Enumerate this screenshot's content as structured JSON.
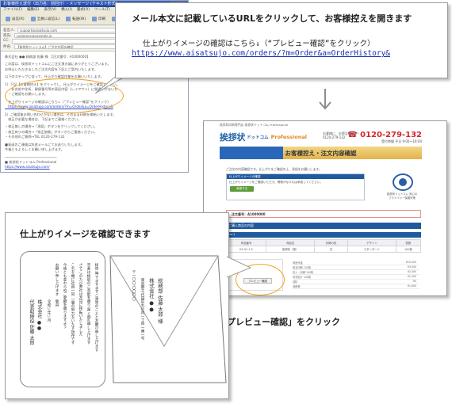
{
  "email": {
    "title_bar": "お客様控え送付（出力名：前回分）- メッセージ (テキスト形式)",
    "menu": [
      "ファイル(F)",
      "編集(E)",
      "表示(V)",
      "挿入(I)",
      "書式(O)",
      "ツール(T)",
      "アクション(A)",
      "ヘルプ(H)"
    ],
    "toolbar": [
      "返信(R)",
      "全員に返信(L)",
      "転送(W)",
      "印刷",
      "削除",
      "前へ",
      "次へ"
    ],
    "headers": {
      "from_label": "差出人:",
      "from_value": "support@aisatsujo.com",
      "to_label": "宛先:",
      "to_value": "customer@example.jp",
      "cc_label": "CC:",
      "cc_value": "",
      "subject_label": "件名:",
      "subject_value": "【挨拶状ドットコム】ご注文内容の確認"
    },
    "body_lines": [
      "株式会社 ●● 総務部 佐藤 様　【注文番号：A1000000】",
      "",
      "この度は、挨拶状ドットコムにご注文頂き誠にありがとうございます。",
      "お申込いただきましたご注文内容を下記にご案内いたします。",
      "",
      "以下のステップに従って、仕上がり確認作業をお願いいたします。",
      "",
      "1）下記【お客様控え】をクリックし、仕上がりイメージをご確認ください。",
      "　・お名前や住所、郵便番号等の表記内容（レイアウト）に間違いがないか",
      "　・ご確認をお願いします。",
      "",
      "　仕上がりイメージの確認はこちら↓（“プレビュー確認”をクリック）",
      "　https://www.aisatsujo.com/orders/?m=Order&a=OrderHistory&",
      "",
      "2）ご確認後お問い合わせがない場合は、そのまま印刷を開始いたします。",
      "　修正が必要な場合は、下記までご連絡ください。",
      "",
      "・修正無しの場合→「承認」ボタンをクリックしてください。",
      "・修正有りの場合→「修正依頼」ボタンからご連絡ください。",
      "・その他のご質問→TEL 0120-279-132",
      "",
      "■発送のご連絡は別途メールにてお送りいたします。",
      "今後ともよろしくお願い申し上げます。",
      "",
      "──────────────────────────",
      "■ 挨拶状ドットコム Professional",
      "https://www.aisatsujo.com/"
    ]
  },
  "callout_top": {
    "heading": "メール本文に記載しているURLをクリックして、お客様控えを開きます",
    "line1": "仕上がりイメージの確認はこちら↓（“プレビュー確認”をクリック）",
    "url": "https://www.aisatsujo.com/orders/?m=Order&a=OrderHistory&"
  },
  "website": {
    "top_note": "挨拶状印刷専門店 挨拶状ドットコム Professional",
    "logo": "挨拶状",
    "logo_sub": "ドットコム",
    "logo_pro": "Professional",
    "head_note": "お客様に、お得な価格で！ 0120-279-132",
    "phone": "0120-279-132",
    "phone_sub": "受付時間 平日 9:00〜18:00",
    "page_title": "お客様控え・注文内容確認",
    "intro": "ご注文の内容確認です。仕上がりをご確認の上、承認をお願いします。",
    "box_title": "仕上がりイメージの確認",
    "box_text": "仕上がりイメージをご確認いただき、問題がなければ承認してください。",
    "box_button": "承認する",
    "badge_caption": "挨拶状ドットコム 安心の プライバシー保護対策",
    "order_number": "注文番号：A1000000",
    "section": "ご購入商品の内容",
    "sub_section": "No.1",
    "table_headers": [
      "商品番号",
      "商品名",
      "封筒の色",
      "デザイン",
      "枚数"
    ],
    "table_row": [
      "KS-51-1.5",
      "挨拶状（縦）",
      "白",
      "スタンダード",
      "100枚"
    ],
    "preview_button": "プレビュー確認",
    "price_lines": [
      {
        "label": "商品代金",
        "value": "¥10,000"
      },
      {
        "label": "宛名印刷 100枚",
        "value": "¥3,000"
      },
      {
        "label": "封入・封緘 100枚",
        "value": "¥2,000"
      },
      {
        "label": "切手貼り 100枚",
        "value": "¥1,000"
      },
      {
        "label": "送料",
        "value": "¥0"
      },
      {
        "label": "消費税",
        "value": "¥1,600"
      }
    ]
  },
  "caption_click": "「プレビュー確認」をクリック",
  "callout_bottom": {
    "heading": "仕上がりイメージを確認できます",
    "card_columns": [
      "拝啓 時下ますますご清栄のこととお慶び申し上げます",
      "平素は格別のご高配を賜り 厚く御礼申し上げます",
      "さてこのたび弊社は左記に移転いたしました",
      "これを機に社員一同 一層の努力をいたす所存です",
      "今後とも変わらぬご愛顧を賜りますよう",
      "お願い申し上げます　敬具",
      "令和○年○月",
      "株式会社 ●●",
      "代表取締役 佐藤 太郎"
    ],
    "envelope_columns": [
      "〒一〇〇‐〇〇〇〇",
      "東京都千代田区丸の内一丁目一番一号",
      "株式会社 ●●",
      "総務部 佐藤 太郎 様"
    ]
  },
  "colors": {
    "highlight": "#f0a21c",
    "link": "#1a2fb0",
    "site_blue": "#1f5a9e",
    "site_gold": "#e3b24b",
    "phone_red": "#d4262b"
  }
}
